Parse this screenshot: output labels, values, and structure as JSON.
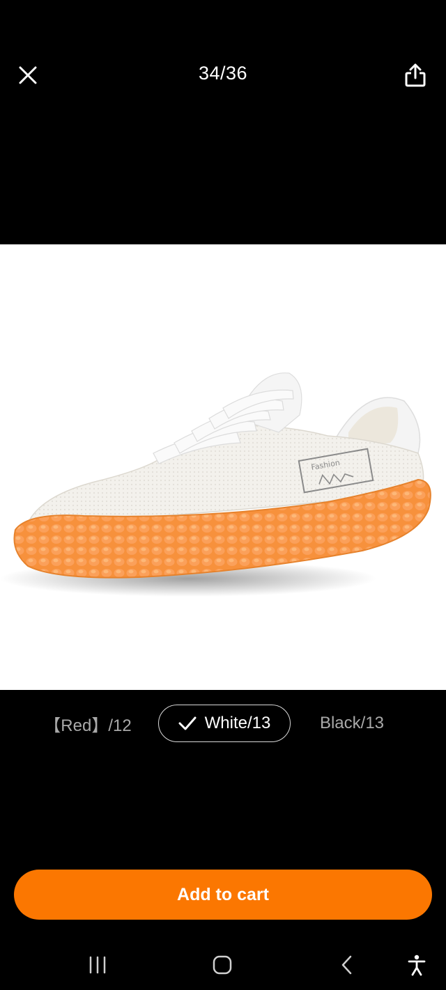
{
  "header": {
    "counter": "34/36",
    "close_icon": "close-icon",
    "share_icon": "share-icon"
  },
  "product": {
    "image_subject": "white knit sneaker with orange sole",
    "shoe_tag_text": "Fashion"
  },
  "variants": [
    {
      "label": "【Red】/12",
      "selected": false
    },
    {
      "label": "White/13",
      "selected": true
    },
    {
      "label": "Black/13",
      "selected": false
    }
  ],
  "cart_button": {
    "label": "Add to cart"
  },
  "colors": {
    "accent": "#fb7701",
    "background": "#000000",
    "text_primary": "#ffffff",
    "text_muted": "#a9a9a9"
  },
  "system_nav": {
    "recents_icon": "recents-icon",
    "home_icon": "home-icon",
    "back_icon": "back-icon",
    "accessibility_icon": "accessibility-icon"
  }
}
